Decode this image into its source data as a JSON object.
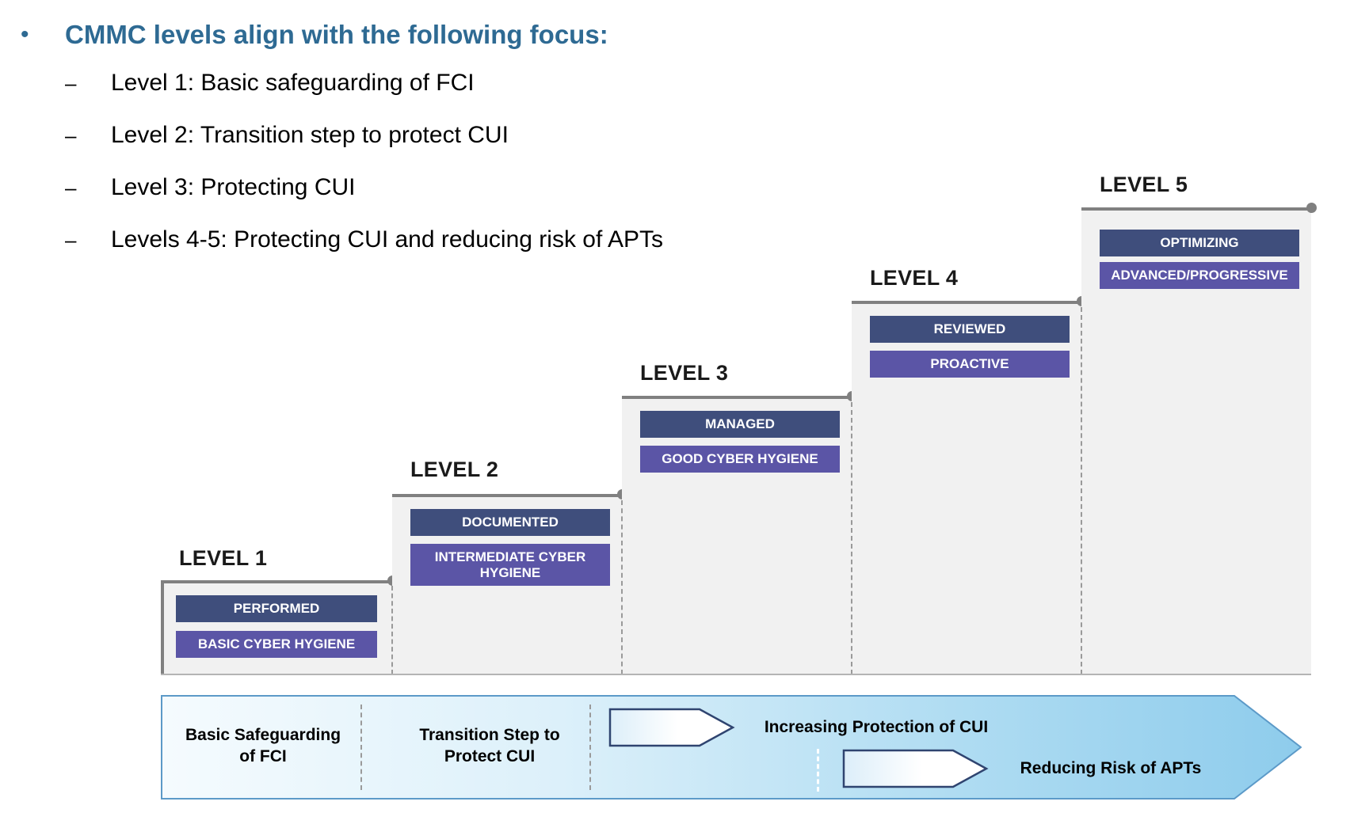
{
  "slide": {
    "title_bullet": {
      "marker": "•",
      "text": "CMMC levels align with the following focus:"
    },
    "sub_bullets": [
      {
        "marker": "–",
        "text": "Level 1: Basic safeguarding of FCI"
      },
      {
        "marker": "–",
        "text": "Level 2: Transition step to protect CUI"
      },
      {
        "marker": "–",
        "text": "Level 3: Protecting CUI"
      },
      {
        "marker": "–",
        "text": "Levels 4-5: Protecting CUI and reducing risk of APTs"
      }
    ]
  },
  "colors": {
    "title_blue": "#2E6A93",
    "band_dark": "#3F4E7C",
    "band_light": "#5B55A6",
    "step_fill": "#F1F1F1",
    "step_border": "#808080",
    "banner_outline": "#3A5480",
    "banner_start": "#F3FAFE",
    "banner_end": "#8ECCEC"
  },
  "staircase": {
    "steps": [
      {
        "level_label": "LEVEL 1",
        "process_band": "PERFORMED",
        "practice_band": "BASIC CYBER HYGIENE"
      },
      {
        "level_label": "LEVEL 2",
        "process_band": "DOCUMENTED",
        "practice_band": "INTERMEDIATE\nCYBER HYGIENE"
      },
      {
        "level_label": "LEVEL 3",
        "process_band": "MANAGED",
        "practice_band": "GOOD CYBER HYGIENE"
      },
      {
        "level_label": "LEVEL 4",
        "process_band": "REVIEWED",
        "practice_band": "PROACTIVE"
      },
      {
        "level_label": "LEVEL 5",
        "process_band": "OPTIMIZING",
        "practice_band": "ADVANCED/PROGRESSIVE"
      }
    ]
  },
  "banner": {
    "labels": [
      "Basic Safeguarding\nof FCI",
      "Transition Step to\nProtect CUI",
      "Increasing Protection of CUI",
      "Reducing Risk of APTs"
    ]
  }
}
